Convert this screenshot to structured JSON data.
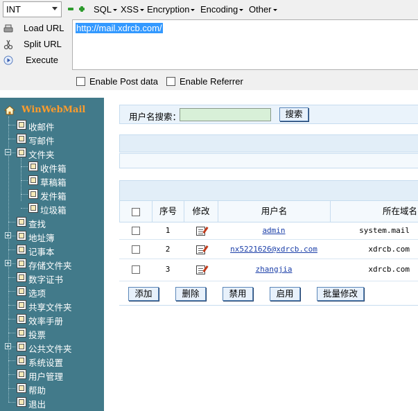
{
  "hackbar": {
    "select_value": "INT",
    "menus": [
      {
        "label": "SQL"
      },
      {
        "label": "XSS"
      },
      {
        "label": "Encryption"
      },
      {
        "label": "Encoding"
      },
      {
        "label": "Other"
      }
    ],
    "actions": {
      "load_url": "Load URL",
      "split_url": "Split URL",
      "execute": "Execute"
    },
    "url_value": "http://mail.xdrcb.com/",
    "enable_post": "Enable Post data",
    "enable_referrer": "Enable Referrer"
  },
  "sidebar": {
    "home": "WinWebMail",
    "items": [
      {
        "label": "收邮件",
        "icon": "inbox-icon"
      },
      {
        "label": "写邮件",
        "icon": "compose-icon"
      },
      {
        "label": "文件夹",
        "icon": "folder-icon"
      },
      {
        "label": "收件箱",
        "icon": "inbox-folder-icon"
      },
      {
        "label": "草稿箱",
        "icon": "drafts-icon"
      },
      {
        "label": "发件箱",
        "icon": "outbox-icon"
      },
      {
        "label": "垃圾箱",
        "icon": "trash-icon"
      },
      {
        "label": "查找",
        "icon": "search-icon"
      },
      {
        "label": "地址簿",
        "icon": "address-book-icon"
      },
      {
        "label": "记事本",
        "icon": "notepad-icon"
      },
      {
        "label": "存储文件夹",
        "icon": "storage-folder-icon"
      },
      {
        "label": "数字证书",
        "icon": "certificate-icon"
      },
      {
        "label": "选项",
        "icon": "options-icon"
      },
      {
        "label": "共享文件夹",
        "icon": "shared-folder-icon"
      },
      {
        "label": "效率手册",
        "icon": "handbook-icon"
      },
      {
        "label": "投票",
        "icon": "vote-icon"
      },
      {
        "label": "公共文件夹",
        "icon": "public-folder-icon"
      },
      {
        "label": "系统设置",
        "icon": "system-settings-icon"
      },
      {
        "label": "用户管理",
        "icon": "user-management-icon"
      },
      {
        "label": "帮助",
        "icon": "help-icon"
      },
      {
        "label": "退出",
        "icon": "logout-icon"
      }
    ]
  },
  "main": {
    "search_label": "用户名搜索：",
    "search_value": "",
    "search_button": "搜索",
    "columns": {
      "index": "序号",
      "edit": "修改",
      "username": "用户名",
      "domain": "所在域名"
    },
    "rows": [
      {
        "index": "1",
        "username": "admin",
        "domain": "system.mail"
      },
      {
        "index": "2",
        "username": "nx5221626@xdrcb.com",
        "domain": "xdrcb.com"
      },
      {
        "index": "3",
        "username": "zhangjia",
        "domain": "xdrcb.com"
      }
    ],
    "buttons": {
      "add": "添加",
      "delete": "删除",
      "disable": "禁用",
      "enable": "启用",
      "batch_edit": "批量修改"
    }
  },
  "colors": {
    "sidebar_bg": "#427a8a",
    "brand": "#ff9c2c",
    "url_selection": "#3399ff",
    "link": "#1a3ea8"
  }
}
